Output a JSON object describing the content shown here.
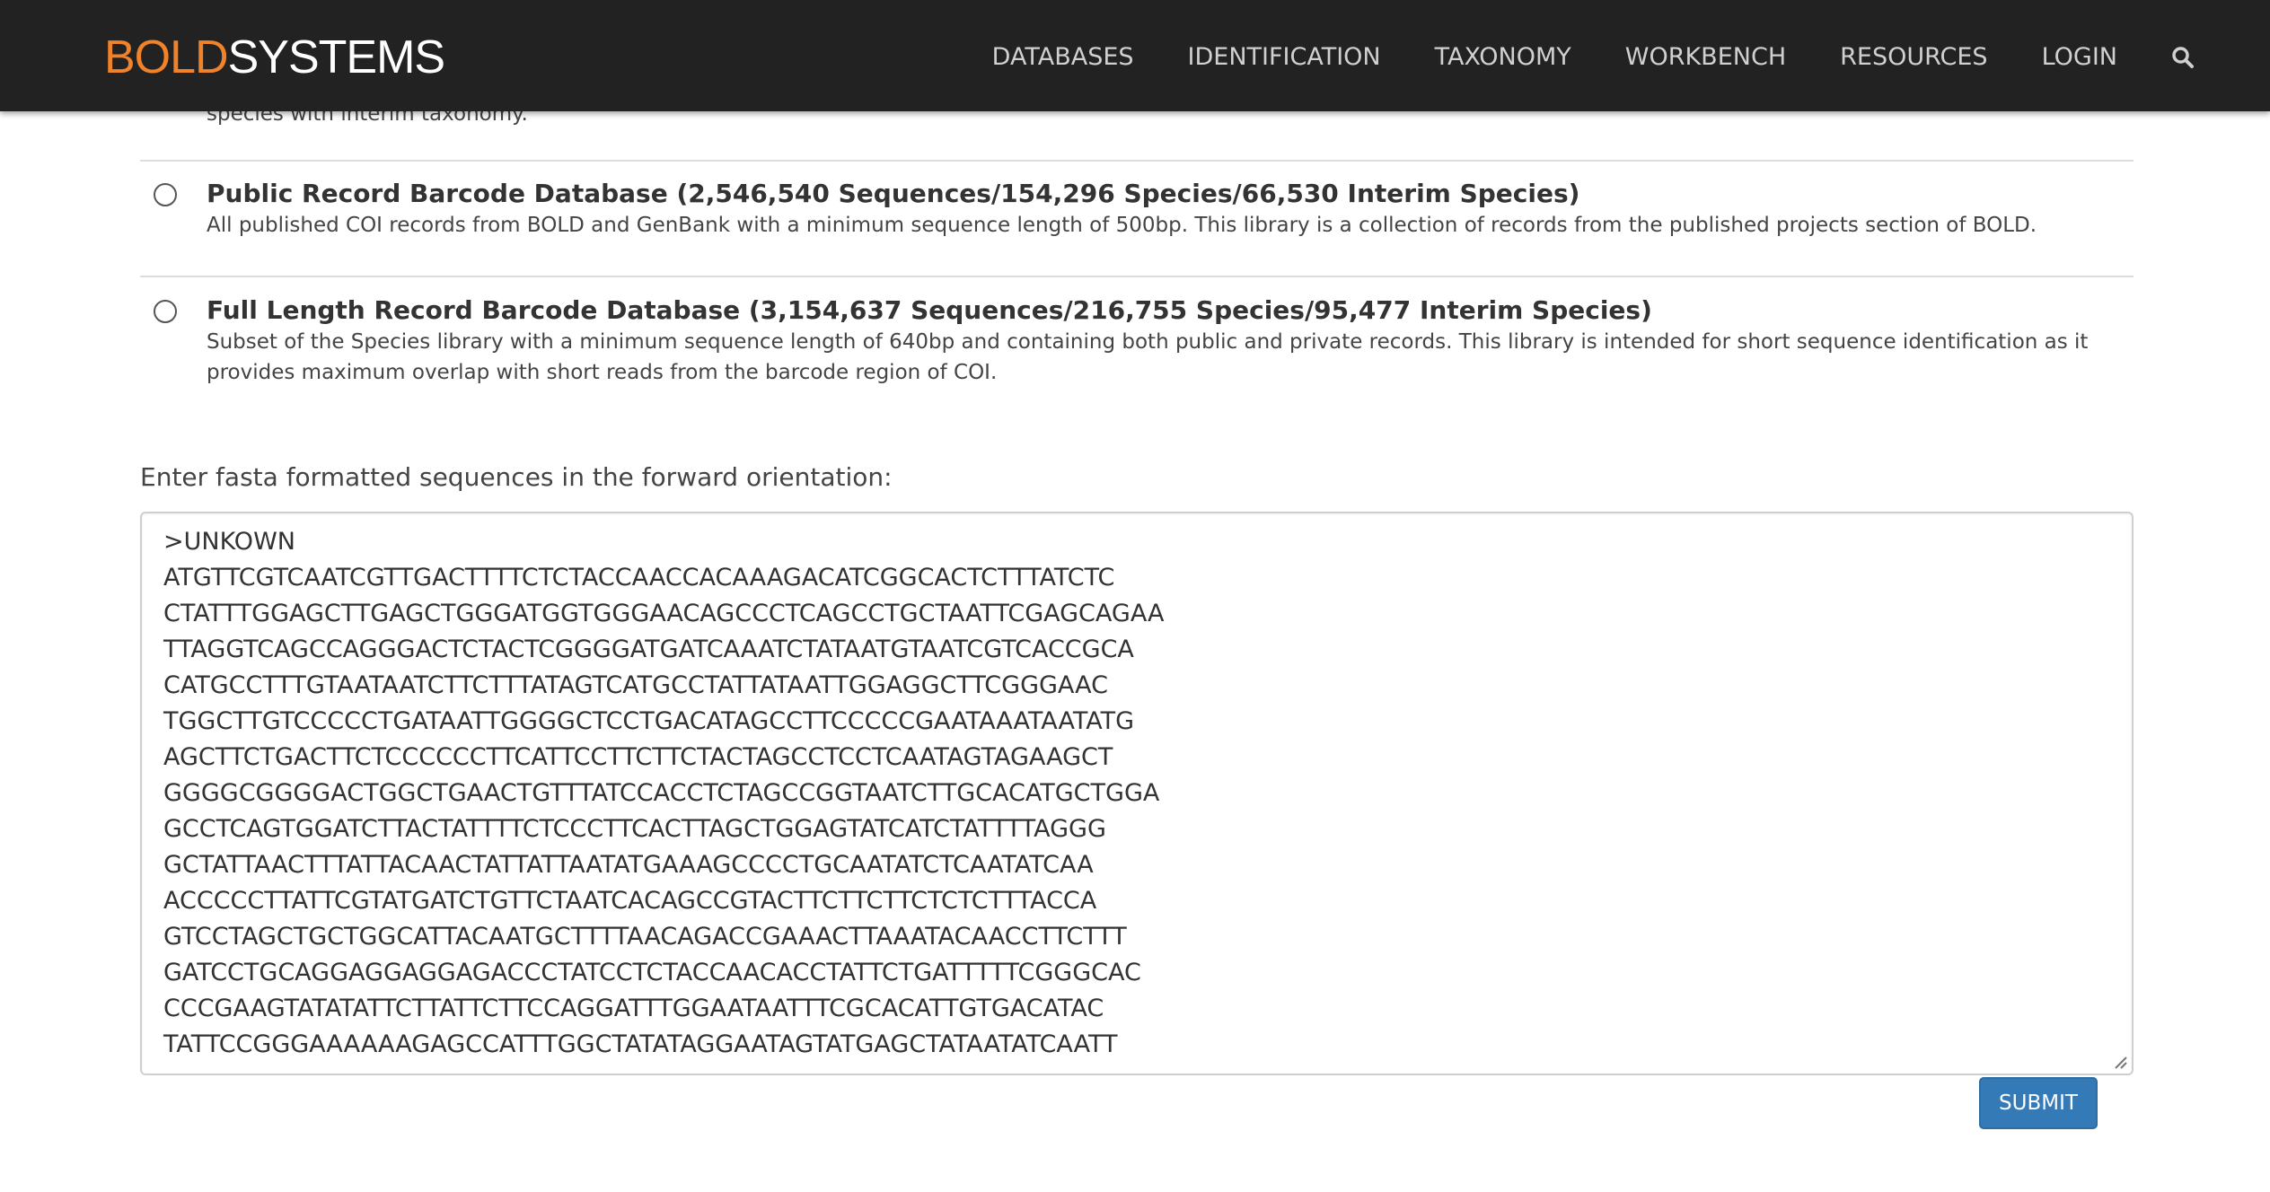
{
  "header": {
    "logo_bold": "BOLD",
    "logo_systems": "SYSTEMS",
    "nav": [
      "DATABASES",
      "IDENTIFICATION",
      "TAXONOMY",
      "WORKBENCH",
      "RESOURCES",
      "LOGIN"
    ],
    "search_icon": "search-icon"
  },
  "partial_option": {
    "desc_tail": "species with interim taxonomy."
  },
  "options": [
    {
      "title": "Public Record Barcode Database (2,546,540 Sequences/154,296 Species/66,530 Interim Species)",
      "desc": "All published COI records from BOLD and GenBank with a minimum sequence length of 500bp. This library is a collection of records from the published projects section of BOLD.",
      "selected": false
    },
    {
      "title": "Full Length Record Barcode Database (3,154,637 Sequences/216,755 Species/95,477 Interim Species)",
      "desc": "Subset of the Species library with a minimum sequence length of 640bp and containing both public and private records. This library is intended for short sequence identification as it provides maximum overlap with short reads from the barcode region of COI.",
      "selected": false
    }
  ],
  "fasta": {
    "label": "Enter fasta formatted sequences in the forward orientation:",
    "value": ">UNKOWN\nATGTTCGTCAATCGTTGACTTTTCTCTACCAACCACAAAGACATCGGCACTCTTTATCTC\nCTATTTGGAGCTTGAGCTGGGATGGTGGGAACAGCCCTCAGCCTGCTAATTCGAGCAGAA\nTTAGGTCAGCCAGGGACTCTACTCGGGGATGATCAAATCTATAATGTAATCGTCACCGCA\nCATGCCTTTGTAATAATCTTCTTTATAGTCATGCCTATTATAATTGGAGGCTTCGGGAAC\nTGGCTTGTCCCCCTGATAATTGGGGCTCCTGACATAGCCTTCCCCCGAATAAATAATATG\nAGCTTCTGACTTCTCCCCCCTTCATTCCTTCTTCTACTAGCCTCCTCAATAGTAGAAGCT\nGGGGCGGGGACTGGCTGAACTGTTTATCCACCTCTAGCCGGTAATCTTGCACATGCTGGA\nGCCTCAGTGGATCTTACTATTTTCTCCCTTCACTTAGCTGGAGTATCATCTATTTTAGGG\nGCTATTAACTTTATTACAACTATTATTAATATGAAAGCCCCTGCAATATCTCAATATCAA\nACCCCCTTATTCGTATGATCTGTTCTAATCACAGCCGTACTTCTTCTTCTCTCTTTACCA\nGTCCTAGCTGCTGGCATTACAATGCTTTTAACAGACCGAAACTTAAATACAACCTTCTTT\nGATCCTGCAGGAGGAGGAGACCCTATCCTCTACCAACACCTATTCTGATTTTTCGGGCAC\nCCCGAAGTATATATTCTTATTCTTCCAGGATTTGGAATAATTTCGCACATTGTGACATAC\nTATTCCGGGAAAAAAGAGCCATTTGGCTATATAGGAATAGTATGAGCTATAATATCAATT"
  },
  "submit_label": "SUBMIT",
  "colors": {
    "header_bg": "#222222",
    "logo_accent": "#f0822a",
    "button_bg": "#337ab7"
  }
}
